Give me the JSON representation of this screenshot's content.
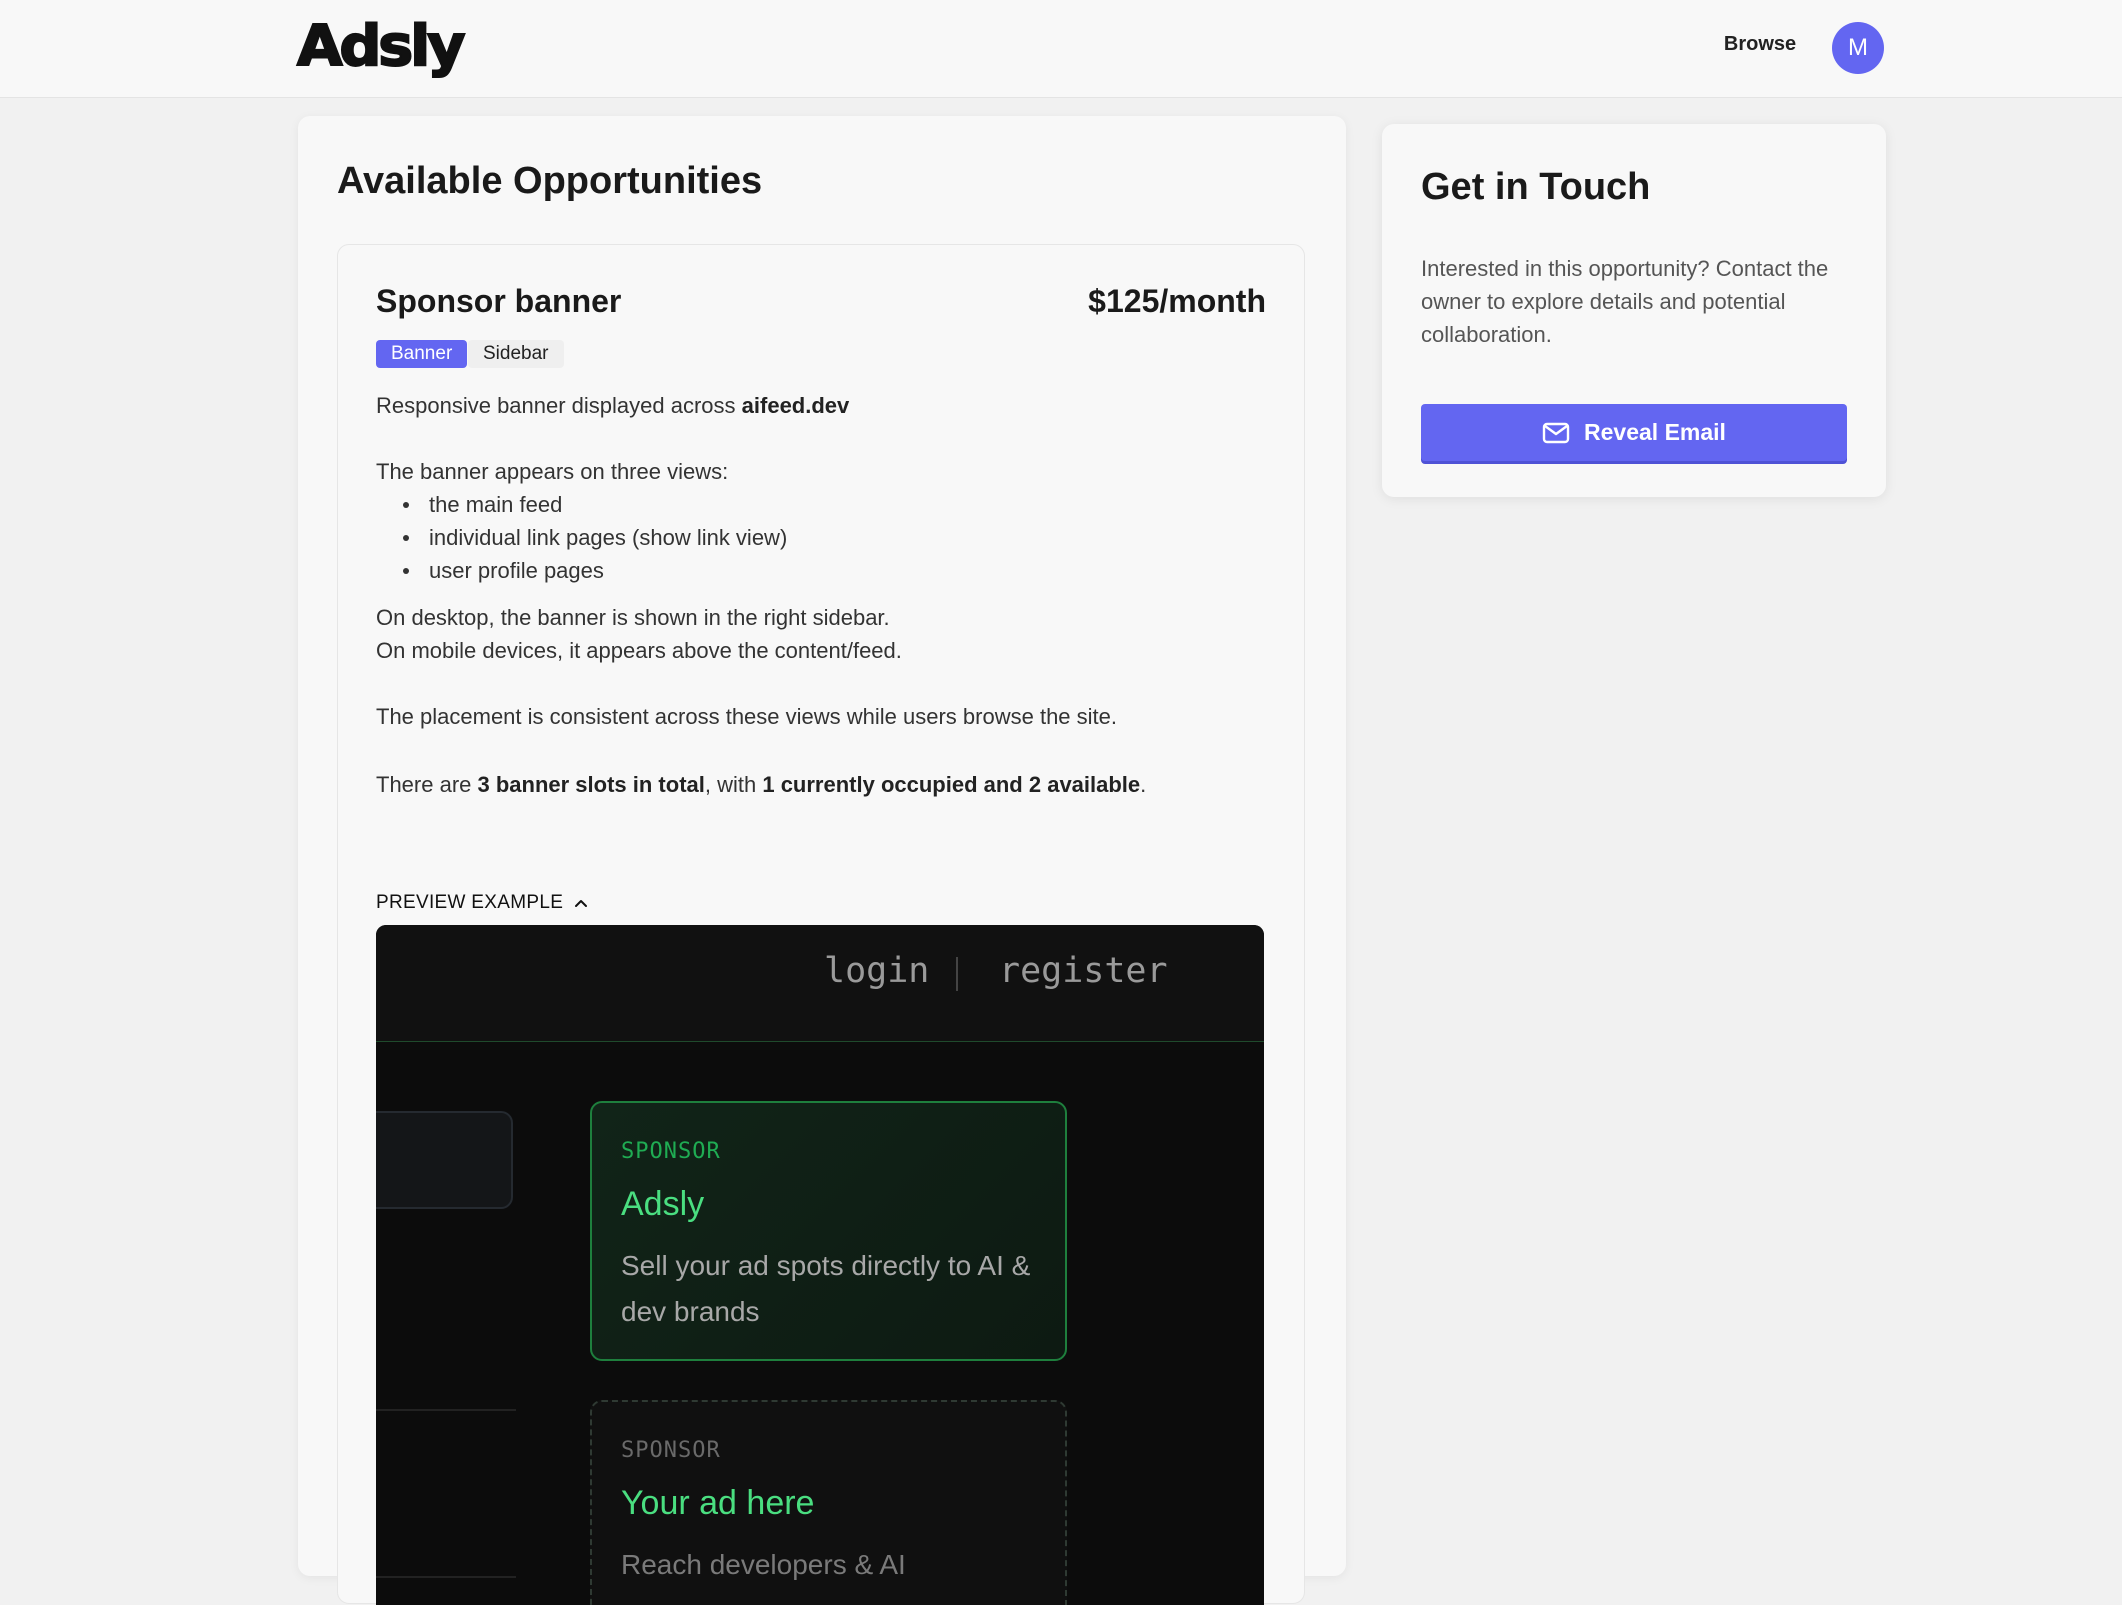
{
  "header": {
    "logo_text": "Adsly",
    "nav_browse": "Browse",
    "avatar_initial": "M"
  },
  "main": {
    "title": "Available Opportunities",
    "opportunity": {
      "title": "Sponsor banner",
      "price": "$125/month",
      "tags": [
        "Banner",
        "Sidebar"
      ],
      "desc_intro": "Responsive banner displayed across ",
      "desc_domain": "aifeed.dev",
      "views_intro": "The banner appears on three views:",
      "views": [
        "the main feed",
        "individual link pages (show link view)",
        "user profile pages"
      ],
      "desktop_note": "On desktop, the banner is shown in the right sidebar.",
      "mobile_note": "On mobile devices, it appears above the content/feed.",
      "consistency_note": "The placement is consistent across these views while users browse the site.",
      "slots_prefix": "There are ",
      "slots_total": "3 banner slots in total",
      "slots_middle": ", with ",
      "slots_status": "1 currently occupied and 2 available",
      "slots_suffix": ".",
      "preview_toggle": "PREVIEW EXAMPLE",
      "preview": {
        "login": "login",
        "separator": "|",
        "register": "register",
        "sponsor_label": "SPONSOR",
        "sponsor_title": "Adsly",
        "sponsor_text": "Sell your ad spots directly to AI & dev brands",
        "slot_label": "SPONSOR",
        "slot_title": "Your ad here",
        "slot_text": "Reach developers & AI",
        "accent_color": "#22c55e"
      }
    }
  },
  "sidebar": {
    "title": "Get in Touch",
    "text": "Interested in this opportunity? Contact the owner to explore details and potential collaboration.",
    "button_label": "Reveal Email",
    "button_icon": "mail-icon",
    "accent_color": "#6366f1"
  }
}
